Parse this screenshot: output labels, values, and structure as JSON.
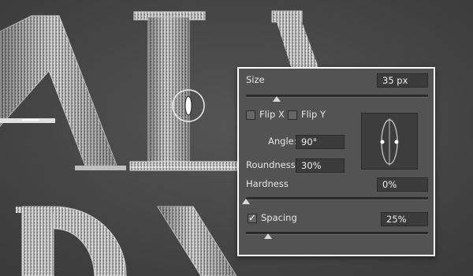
{
  "panel": {
    "size_label": "Size",
    "size_value": "35 px",
    "size_slider_fraction": 0.17,
    "flip_x_label": "Flip X",
    "flip_x_checked": false,
    "flip_y_label": "Flip Y",
    "flip_y_checked": false,
    "angle_label": "Angle:",
    "angle_value": "90°",
    "roundness_label": "Roundness:",
    "roundness_value": "30%",
    "hardness_label": "Hardness",
    "hardness_value": "0%",
    "hardness_slider_fraction": 0.0,
    "spacing_label": "Spacing",
    "spacing_checked": true,
    "spacing_value": "25%",
    "spacing_slider_fraction": 0.12
  },
  "canvas": {
    "letters": [
      "A",
      "I",
      "D",
      "A"
    ],
    "texture": "silver-metallic-glitter"
  },
  "colors": {
    "canvas_bg": "#4a4a4a",
    "panel_bg": "#535353",
    "panel_border": "#ffffff",
    "field_bg": "#3b3b3b"
  },
  "icons": {
    "brush_cursor": "elliptical-brush-cursor-icon",
    "brush_tip_preview": "brush-tip-shape-icon"
  }
}
